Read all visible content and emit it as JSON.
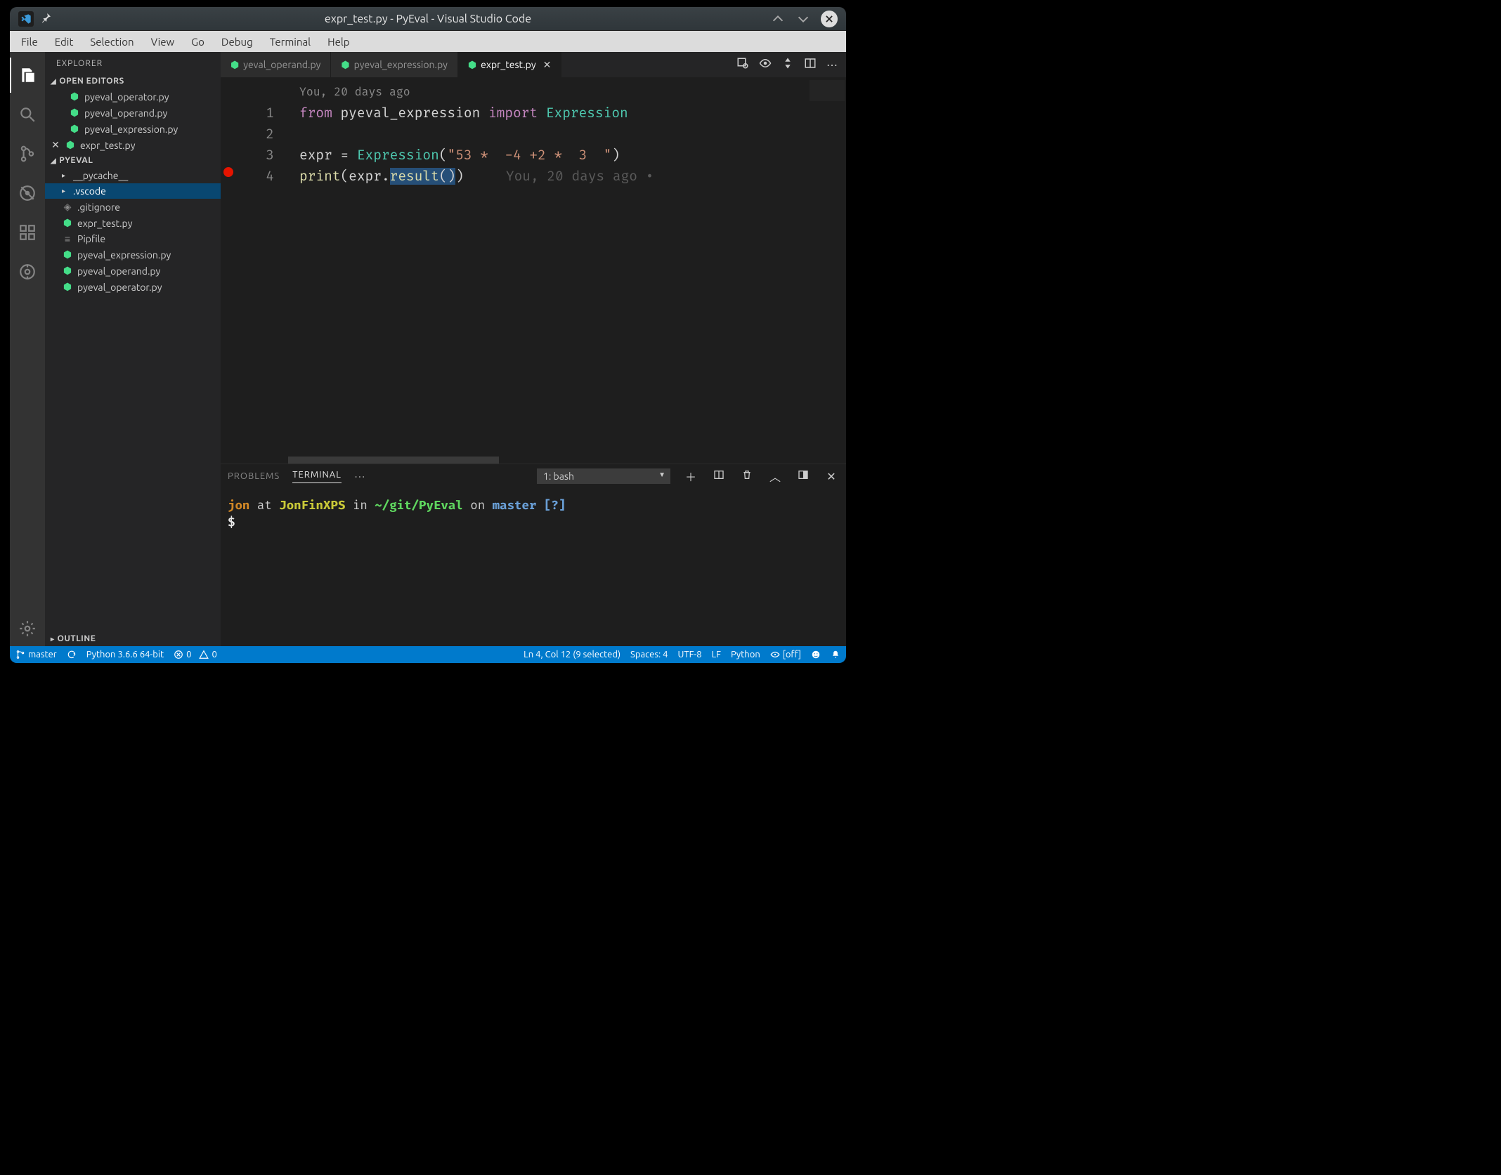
{
  "window": {
    "title": "expr_test.py - PyEval - Visual Studio Code"
  },
  "menu": [
    "File",
    "Edit",
    "Selection",
    "View",
    "Go",
    "Debug",
    "Terminal",
    "Help"
  ],
  "activity": [
    "explorer",
    "search",
    "scm",
    "debug",
    "extensions",
    "gitlens",
    "gear"
  ],
  "explorer": {
    "title": "EXPLORER",
    "openEditors": {
      "label": "OPEN EDITORS",
      "items": [
        {
          "name": "pyeval_operator.py",
          "dirty": false
        },
        {
          "name": "pyeval_operand.py",
          "dirty": false
        },
        {
          "name": "pyeval_expression.py",
          "dirty": false
        },
        {
          "name": "expr_test.py",
          "dirty": true
        }
      ]
    },
    "project": {
      "label": "PYEVAL",
      "tree": [
        {
          "type": "folder",
          "name": "__pycache__",
          "selected": false
        },
        {
          "type": "folder",
          "name": ".vscode",
          "selected": true
        },
        {
          "type": "file",
          "name": ".gitignore",
          "icon": "git"
        },
        {
          "type": "file",
          "name": "expr_test.py",
          "icon": "py"
        },
        {
          "type": "file",
          "name": "Pipfile",
          "icon": "pip"
        },
        {
          "type": "file",
          "name": "pyeval_expression.py",
          "icon": "py"
        },
        {
          "type": "file",
          "name": "pyeval_operand.py",
          "icon": "py"
        },
        {
          "type": "file",
          "name": "pyeval_operator.py",
          "icon": "py"
        }
      ]
    },
    "outline": "OUTLINE"
  },
  "tabs": [
    {
      "label": "yeval_operand.py",
      "active": false,
      "close": false,
      "trunc": true
    },
    {
      "label": "pyeval_expression.py",
      "active": false,
      "close": false
    },
    {
      "label": "expr_test.py",
      "active": true,
      "close": true
    }
  ],
  "codelens": "You, 20 days ago",
  "lines": [
    1,
    2,
    3,
    4
  ],
  "code": {
    "l1_from": "from",
    "l1_mod": "pyeval_expression",
    "l1_import": "import",
    "l1_cls": "Expression",
    "l3_var": "expr",
    "l3_eq": " = ",
    "l3_cls": "Expression",
    "l3_op": "(",
    "l3_str": "\"53 *  -4 +2 *  3  \"",
    "l3_cp": ")",
    "l4_fn": "print",
    "l4_op": "(",
    "l4_obj": "expr",
    "l4_dot": ".",
    "l4_meth": "result",
    "l4_call": "())",
    "l4_blame": "You, 20 days ago •"
  },
  "panel": {
    "tabs": [
      "PROBLEMS",
      "TERMINAL"
    ],
    "active": "TERMINAL",
    "termSelect": "1: bash",
    "prompt": {
      "user": "jon",
      "at": " at ",
      "host": "JonFinXPS",
      "in": " in ",
      "path": "~/git/PyEval",
      "on": " on ",
      "branch": "master ",
      "flag": "[?]",
      "ps": "$"
    }
  },
  "status": {
    "branch": "master",
    "python": "Python 3.6.6 64-bit",
    "errors": "0",
    "warnings": "0",
    "cursor": "Ln 4, Col 12 (9 selected)",
    "spaces": "Spaces: 4",
    "encoding": "UTF-8",
    "eol": "LF",
    "lang": "Python",
    "live": "[off]"
  }
}
